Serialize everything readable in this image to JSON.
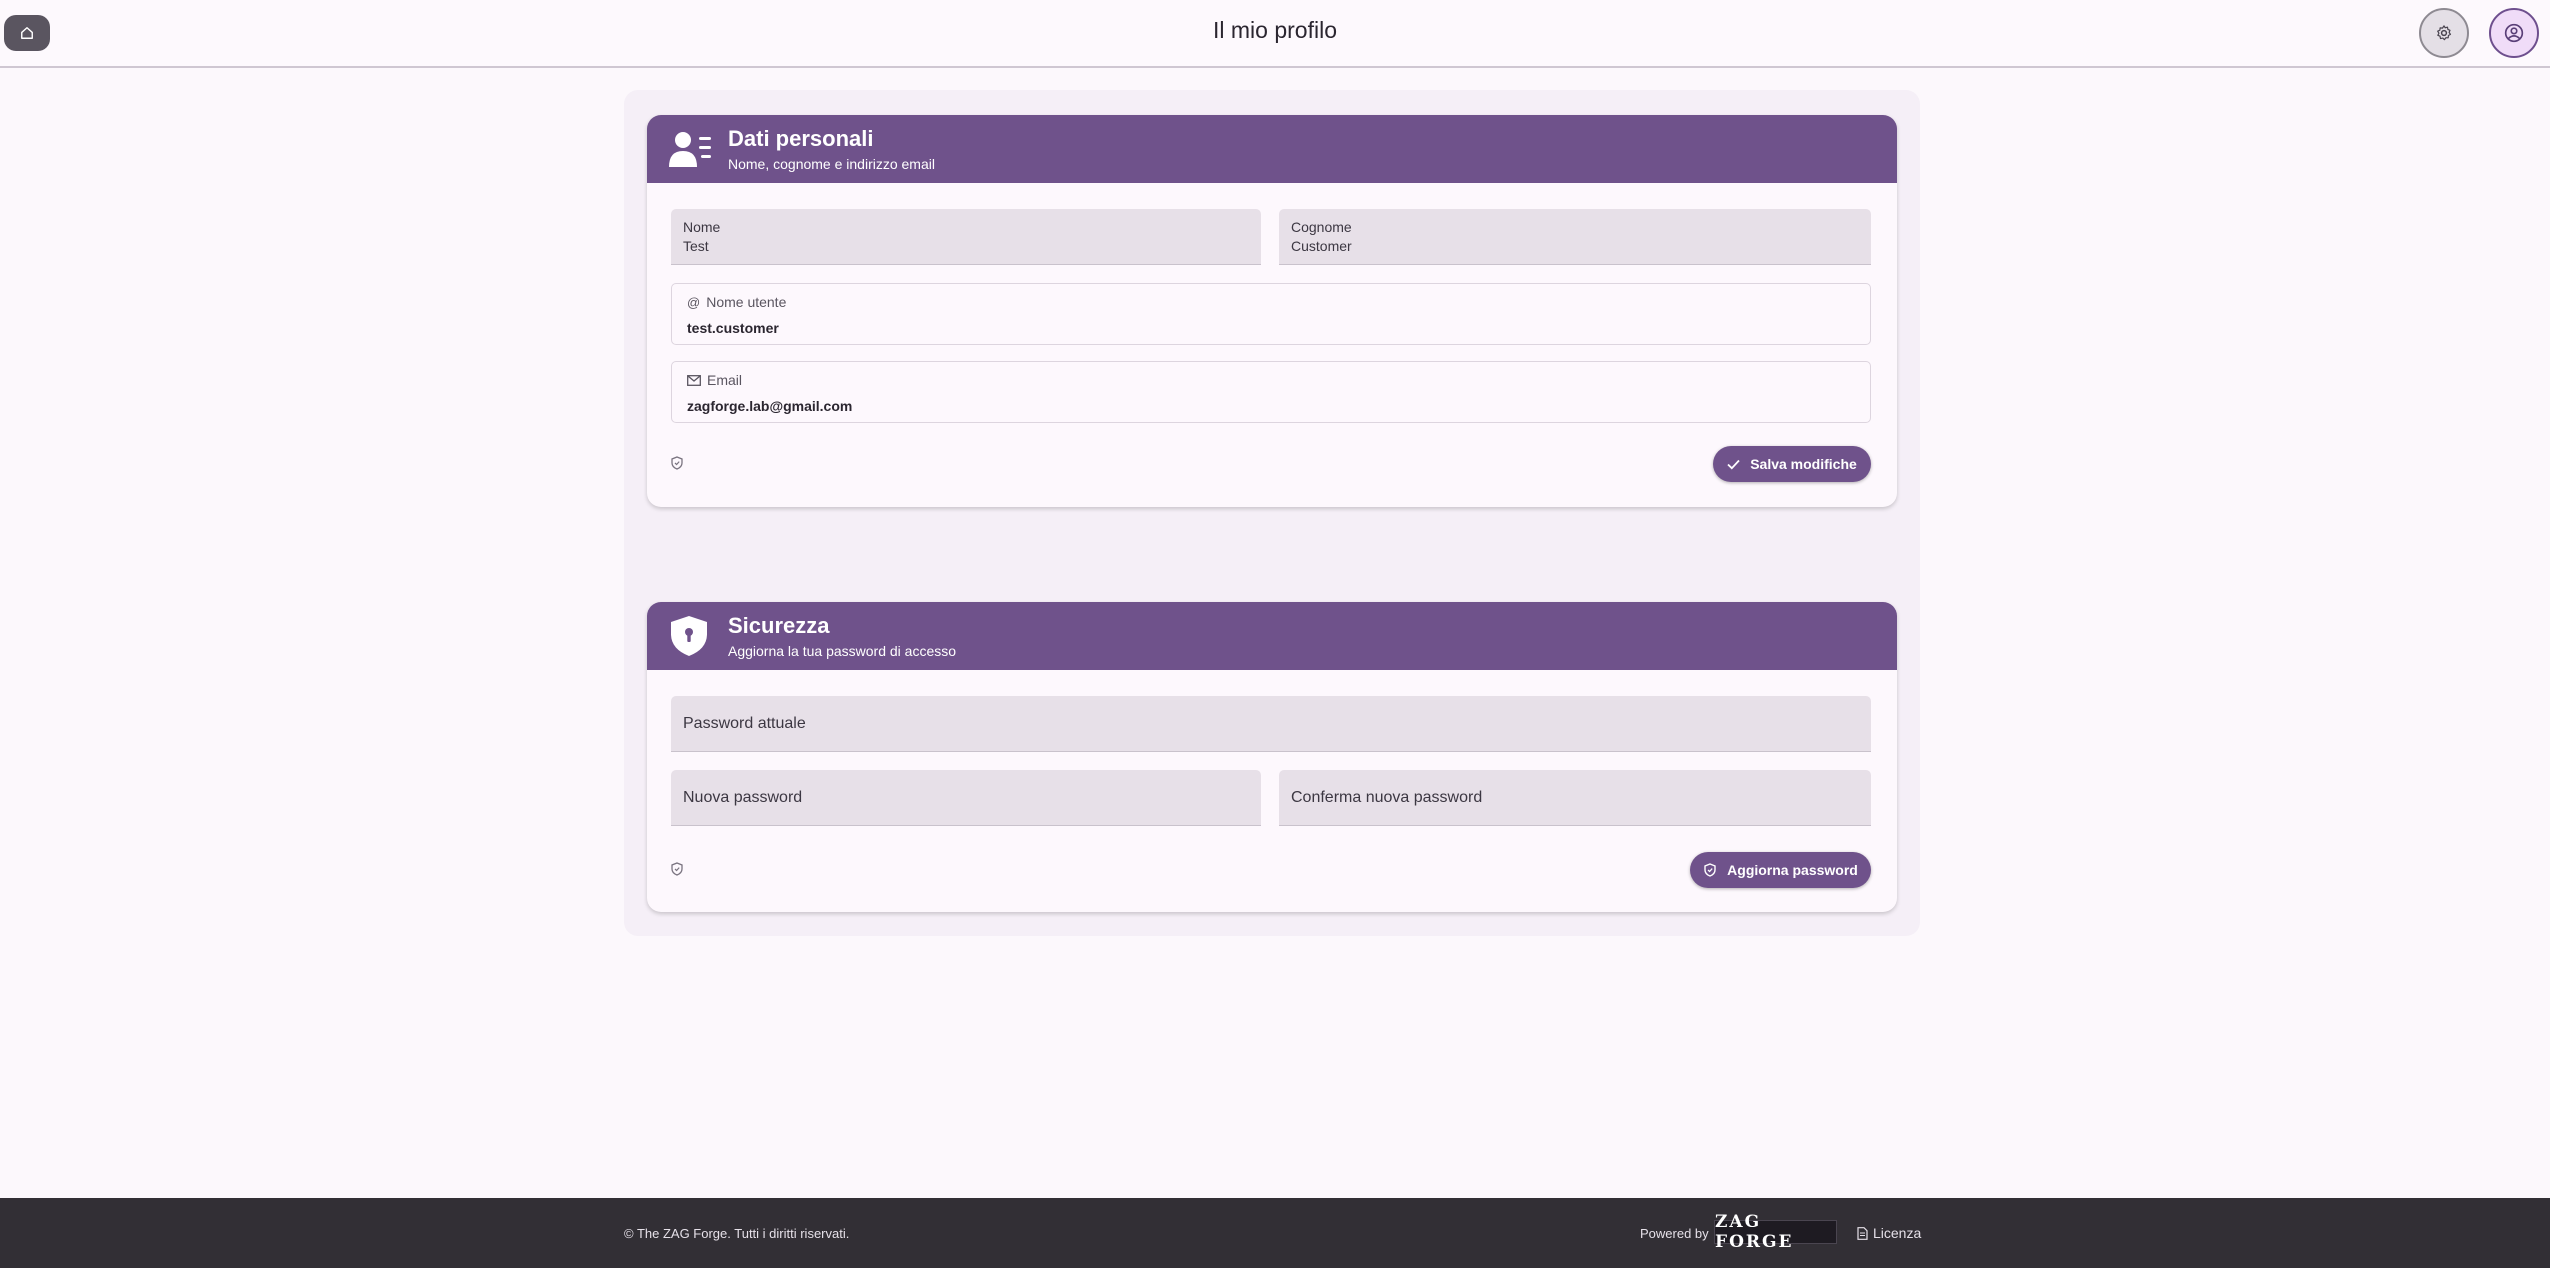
{
  "header": {
    "title": "Il mio profilo",
    "home_icon": "home-icon",
    "settings_icon": "gear-icon",
    "profile_icon": "user-circle-icon"
  },
  "personal": {
    "title": "Dati personali",
    "subtitle": "Nome, cognome e indirizzo email",
    "icon": "user-card-icon",
    "first_name_label": "Nome",
    "first_name_value": "Test",
    "last_name_label": "Cognome",
    "last_name_value": "Customer",
    "username_label": "Nome utente",
    "username_value": "test.customer",
    "email_label": "Email",
    "email_value": "zagforge.lab@gmail.com",
    "save_label": "Salva modifiche"
  },
  "security": {
    "title": "Sicurezza",
    "subtitle": "Aggiorna la tua password di accesso",
    "icon": "shield-lock-icon",
    "current_password_placeholder": "Password attuale",
    "new_password_placeholder": "Nuova password",
    "confirm_password_placeholder": "Conferma nuova password",
    "update_label": "Aggiorna password"
  },
  "footer": {
    "copyright": "© The ZAG Forge. Tutti i diritti riservati.",
    "powered_by": "Powered by",
    "logo_text": "ZAG FORGE",
    "license_label": "Licenza"
  },
  "colors": {
    "accent": "#6f528b",
    "background": "#fcf8fc",
    "footer": "#322f35"
  }
}
